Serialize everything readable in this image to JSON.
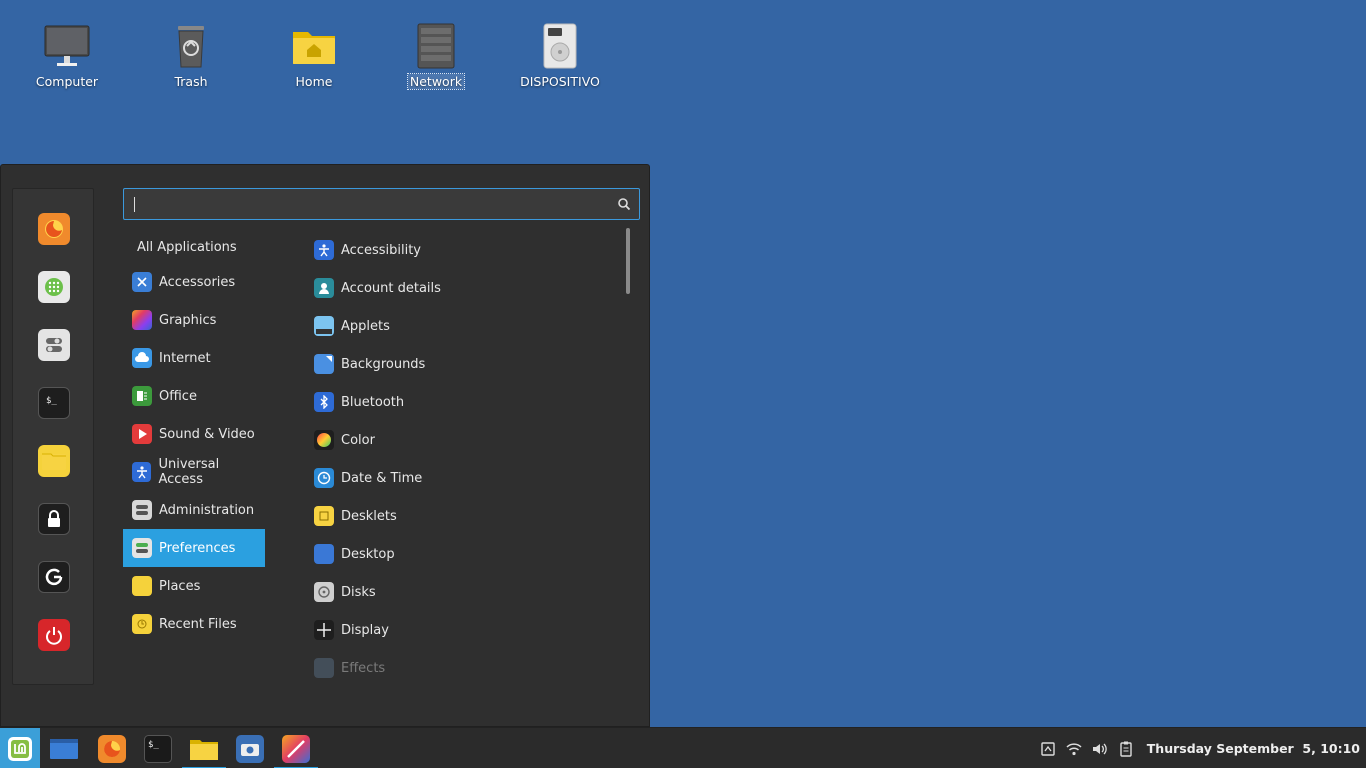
{
  "desktop": {
    "icons": [
      {
        "label": "Computer",
        "icon": "computer-icon"
      },
      {
        "label": "Trash",
        "icon": "trash-icon"
      },
      {
        "label": "Home",
        "icon": "home-folder-icon"
      },
      {
        "label": "Network",
        "icon": "network-icon"
      },
      {
        "label": "DISPOSITIVO",
        "icon": "drive-icon"
      }
    ]
  },
  "menu": {
    "search": {
      "value": "",
      "placeholder": ""
    },
    "favorites": [
      "firefox-icon",
      "software-manager-icon",
      "system-settings-icon",
      "terminal-icon",
      "files-icon",
      "lock-screen-icon",
      "logout-icon",
      "power-icon"
    ],
    "categories": [
      {
        "label": "All Applications"
      },
      {
        "label": "Accessories"
      },
      {
        "label": "Graphics"
      },
      {
        "label": "Internet"
      },
      {
        "label": "Office"
      },
      {
        "label": "Sound & Video"
      },
      {
        "label": "Universal Access"
      },
      {
        "label": "Administration"
      },
      {
        "label": "Preferences"
      },
      {
        "label": "Places"
      },
      {
        "label": "Recent Files"
      }
    ],
    "active_category": "Preferences",
    "apps": [
      {
        "label": "Accessibility"
      },
      {
        "label": "Account details"
      },
      {
        "label": "Applets"
      },
      {
        "label": "Backgrounds"
      },
      {
        "label": "Bluetooth"
      },
      {
        "label": "Color"
      },
      {
        "label": "Date & Time"
      },
      {
        "label": "Desklets"
      },
      {
        "label": "Desktop"
      },
      {
        "label": "Disks"
      },
      {
        "label": "Display"
      },
      {
        "label": "Effects"
      }
    ]
  },
  "panel": {
    "taskbar": [
      "mint-menu-icon",
      "show-desktop-icon",
      "firefox-icon",
      "terminal-icon",
      "files-icon",
      "screenshot-icon",
      "drawing-icon"
    ],
    "tray": [
      "keyboard-icon",
      "wifi-icon",
      "volume-icon",
      "clipboard-icon"
    ],
    "clock": "Thursday September  5, 10:10"
  },
  "colors": {
    "desktop_bg": "#3465a4",
    "accent": "#2ba0e0",
    "menu_bg": "#2f2f2f"
  }
}
